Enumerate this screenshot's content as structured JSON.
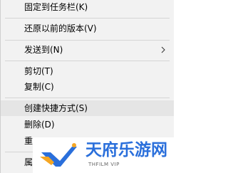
{
  "context_menu": {
    "items": [
      {
        "label": "固定到任务栏(K)"
      },
      {
        "label": "还原以前的版本(V)"
      },
      {
        "label": "发送到(N)",
        "submenu_icon": "chevron-right-icon"
      },
      {
        "label": "剪切(T)"
      },
      {
        "label": "复制(C)"
      },
      {
        "label": "创建快捷方式(S)",
        "highlighted": true
      },
      {
        "label": "删除(D)"
      },
      {
        "label": "重"
      },
      {
        "label": "属"
      }
    ]
  },
  "watermark": {
    "title": "天府乐游网",
    "subtitle": "THFILM VIP",
    "color": "#2a6fdb",
    "accent": "#f5a623"
  }
}
